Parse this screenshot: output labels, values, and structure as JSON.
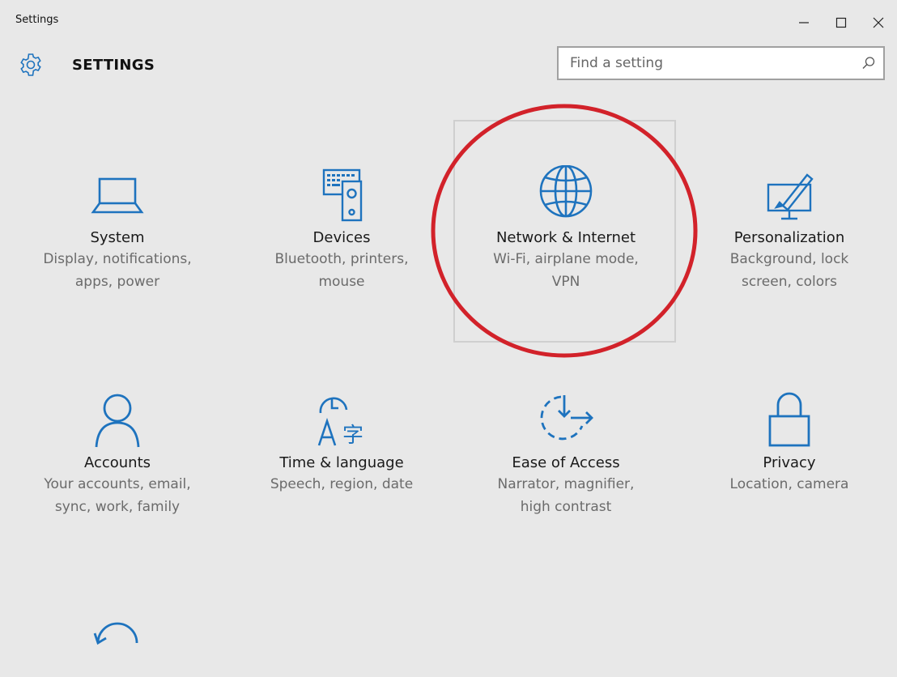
{
  "window": {
    "title": "Settings",
    "controls": {
      "minimize_icon": "minimize-icon",
      "maximize_icon": "maximize-icon",
      "close_icon": "close-icon"
    }
  },
  "header": {
    "icon": "gear-icon",
    "title": "SETTINGS",
    "search": {
      "placeholder": "Find a setting",
      "value": "",
      "icon": "search-icon"
    }
  },
  "colors": {
    "accent": "#1e73be",
    "background": "#e8e8e8",
    "annotation": "#d2222a"
  },
  "tiles": [
    {
      "name": "System",
      "desc": "Display, notifications,\napps, power",
      "icon": "laptop-icon"
    },
    {
      "name": "Devices",
      "desc": "Bluetooth, printers,\nmouse",
      "icon": "keyboard-speaker-icon"
    },
    {
      "name": "Network & Internet",
      "desc": "Wi-Fi, airplane mode,\nVPN",
      "icon": "globe-icon"
    },
    {
      "name": "Personalization",
      "desc": "Background, lock\nscreen, colors",
      "icon": "monitor-brush-icon"
    },
    {
      "name": "Accounts",
      "desc": "Your accounts, email,\nsync, work, family",
      "icon": "person-icon"
    },
    {
      "name": "Time & language",
      "desc": "Speech, region, date",
      "icon": "clock-language-icon"
    },
    {
      "name": "Ease of Access",
      "desc": "Narrator, magnifier,\nhigh contrast",
      "icon": "ease-of-access-icon"
    },
    {
      "name": "Privacy",
      "desc": "Location, camera",
      "icon": "lock-icon"
    },
    {
      "name": "",
      "desc": "",
      "icon": "update-icon"
    }
  ]
}
